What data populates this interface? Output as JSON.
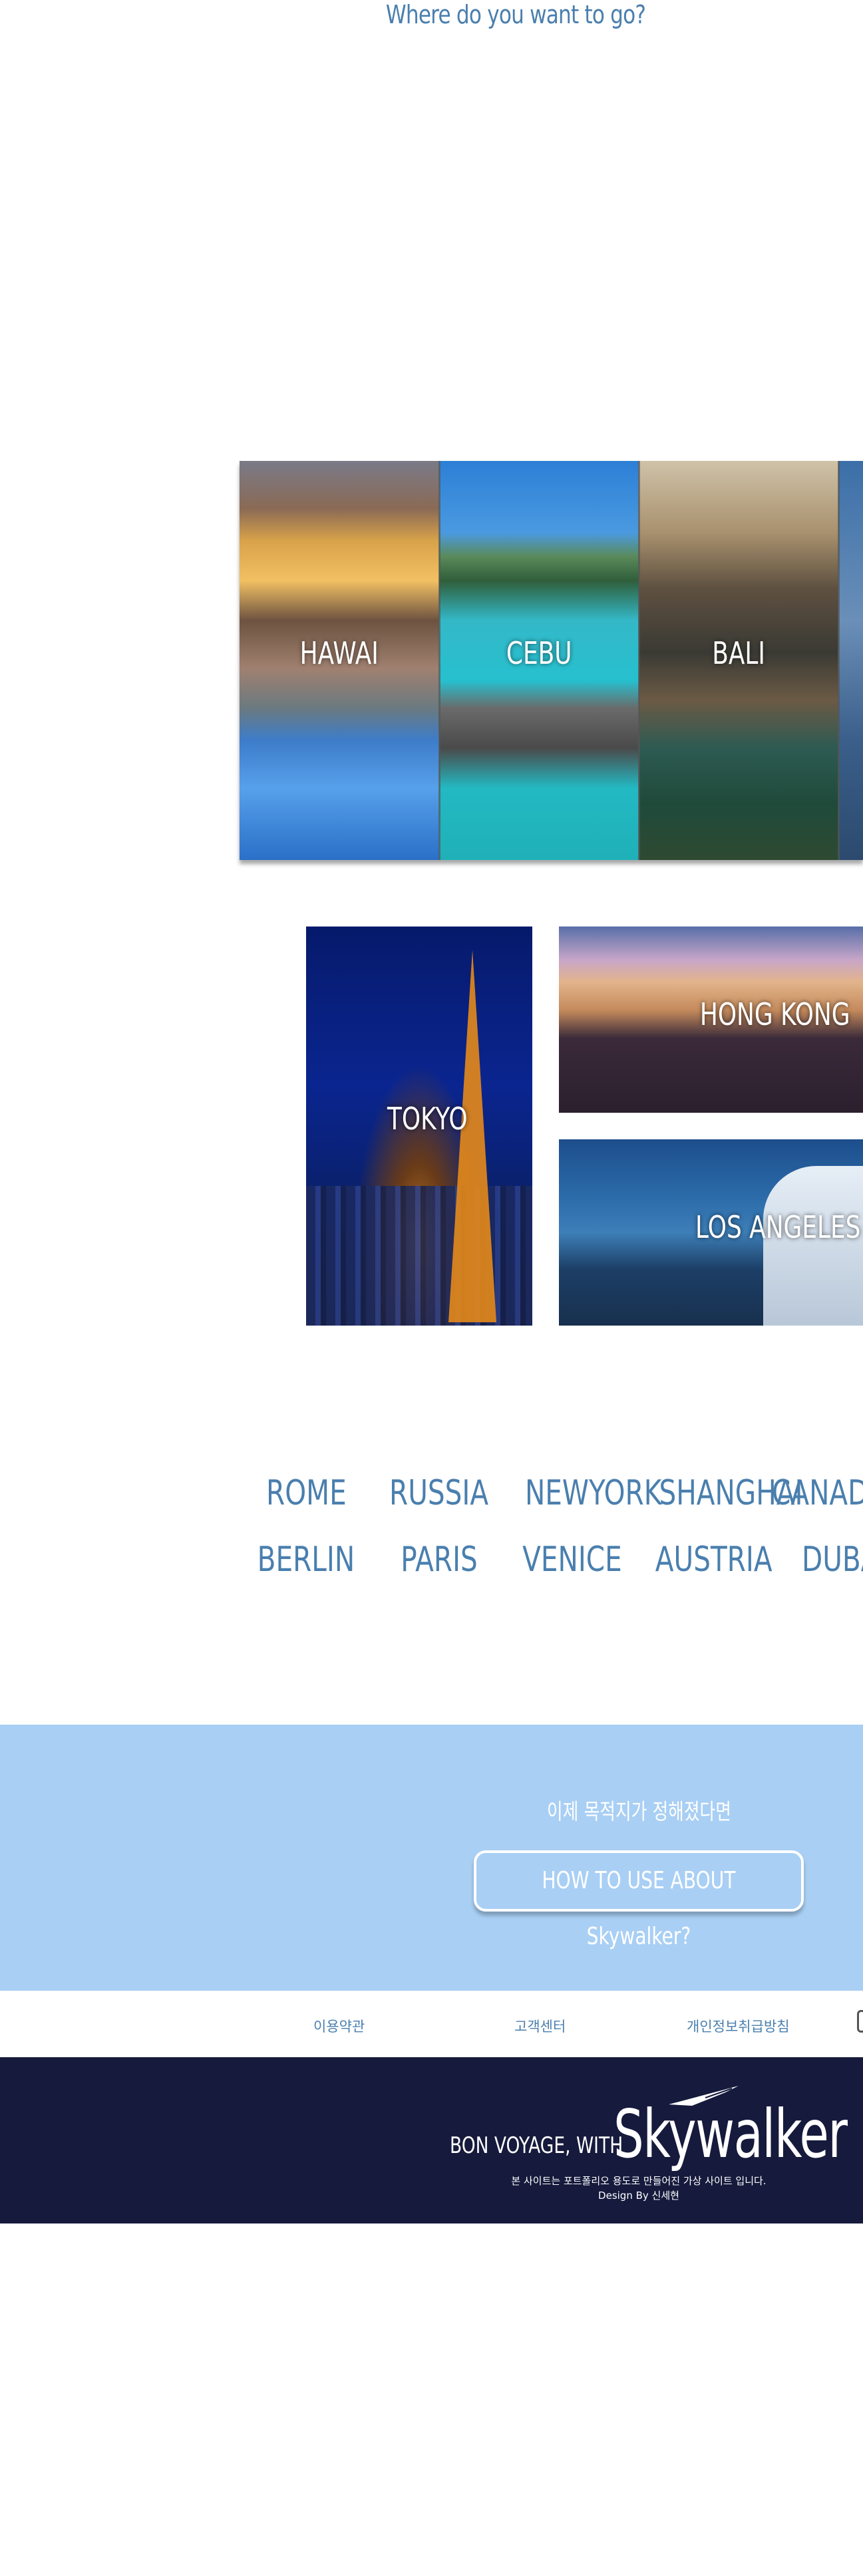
{
  "heading": "Where do you want to go?",
  "strip": {
    "items": [
      {
        "label": "HAWAI"
      },
      {
        "label": "CEBU"
      },
      {
        "label": "BALI"
      }
    ]
  },
  "feature": {
    "tokyo": "TOKYO",
    "hongkong": "HONG KONG",
    "losangeles": "LOS ANGELES"
  },
  "cities": {
    "row1": [
      "ROME",
      "RUSSIA",
      "NEWYORK",
      "SHANGHAI",
      "CANAD"
    ],
    "row2": [
      "BERLIN",
      "PARIS",
      "VENICE",
      "AUSTRIA",
      "DUBA"
    ]
  },
  "cta": {
    "text": "이제 목적지가 정해졌다면",
    "button": "HOW TO USE ABOUT Skywalker?"
  },
  "links": [
    "이용약관",
    "고객센터",
    "개인정보취급방침"
  ],
  "footer": {
    "tagline": "BON VOYAGE, WITH",
    "brand": "Skywalker",
    "note": "본 사이트는 포트폴리오 용도로 만들어진 가상 사이트 입니다.",
    "design": "Design By 신세현"
  },
  "colors": {
    "accent": "#4a7fae",
    "cta_bg": "#a9cff4",
    "footer_bg": "#161a3c"
  }
}
